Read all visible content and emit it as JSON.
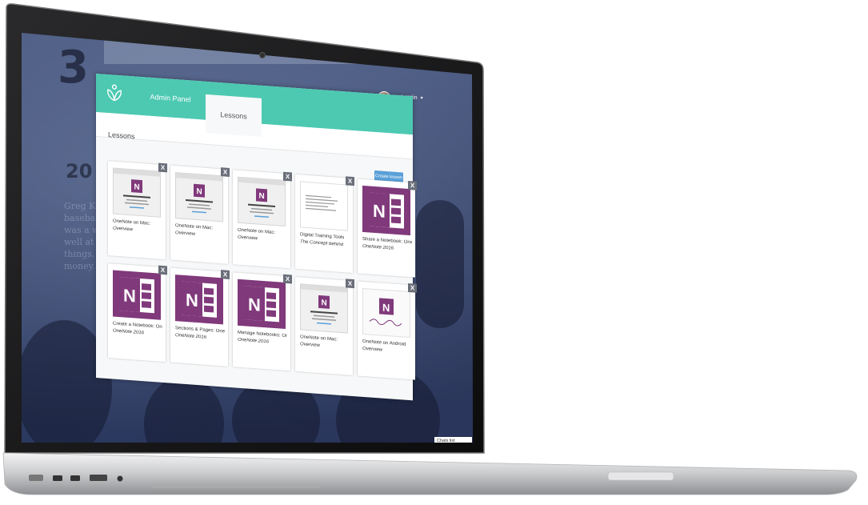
{
  "user": {
    "name": "Ulrik Wiin"
  },
  "header": {
    "tabs": [
      {
        "label": "Admin Panel"
      },
      {
        "label": "Lessons"
      }
    ]
  },
  "main": {
    "title": "Lessons",
    "create_button": "Create lesson",
    "lessons": [
      {
        "title": "OneNote on Mac:",
        "subtitle": "Overview",
        "thumb": "screenshot"
      },
      {
        "title": "OneNote on Mac:",
        "subtitle": "Overview",
        "thumb": "screenshot"
      },
      {
        "title": "OneNote on Mac:",
        "subtitle": "Overview",
        "thumb": "screenshot"
      },
      {
        "title": "Digital Training Tools",
        "subtitle": "The Concept behind",
        "thumb": "doc"
      },
      {
        "title": "Share a Notebook: One...",
        "subtitle": "OneNote 2016",
        "thumb": "onenote-icon"
      },
      {
        "title": "Create a Notebook: On...",
        "subtitle": "OneNote 2016",
        "thumb": "onenote-icon"
      },
      {
        "title": "Sections & Pages: OneN...",
        "subtitle": "OneNote 2016",
        "thumb": "onenote-icon"
      },
      {
        "title": "Manage Notebooks: On...",
        "subtitle": "OneNote 2016",
        "thumb": "onenote-icon"
      },
      {
        "title": "OneNote on Mac:",
        "subtitle": "Overview",
        "thumb": "screenshot"
      },
      {
        "title": "OneNote on Android",
        "subtitle": "Overview",
        "thumb": "android"
      }
    ],
    "close_label": "X"
  },
  "footer": {
    "chats": "Chats list"
  },
  "colors": {
    "header": "#4dc9b2",
    "accent_button": "#5a9fd8",
    "onenote_purple": "#80397b"
  },
  "icons": [
    "lotus-logo-icon",
    "onenote-icon",
    "close-icon",
    "caret-down-icon"
  ]
}
